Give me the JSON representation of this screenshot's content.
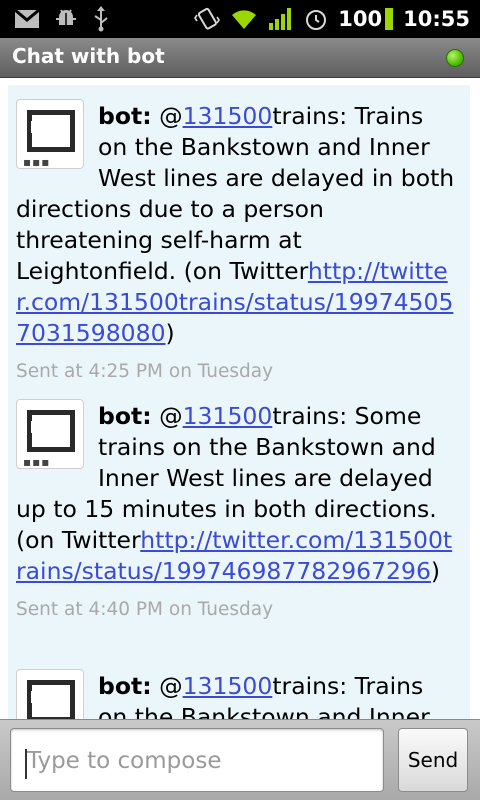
{
  "status_bar": {
    "battery_level": "100",
    "time": "10:55",
    "icons": [
      "gmail-icon",
      "android-debug-icon",
      "usb-icon",
      "vibrate-icon",
      "wifi-icon",
      "signal-icon",
      "alarm-icon",
      "battery-icon"
    ]
  },
  "title_bar": {
    "title": "Chat with bot",
    "presence_color": "#4fc000"
  },
  "messages": [
    {
      "sender": "bot:",
      "at_sign": "@",
      "mention_link": "131500",
      "text_1": "trains: Trains on the Bankstown and Inner West lines are delayed in both directions due to a person threatening self-harm at Leightonfield. (on Twitter",
      "url_link": "http://twitter.com/131500trains/status/199745057031598080",
      "text_2": ")",
      "sent_at": "Sent at 4:25 PM on Tuesday"
    },
    {
      "sender": "bot:",
      "at_sign": "@",
      "mention_link": "131500",
      "text_1": "trains: Some trains on the Bankstown and Inner West lines are delayed up to 15 minutes in both directions. (on Twitter",
      "url_link": "http://twitter.com/131500trains/status/199746987782967296",
      "text_2": ")",
      "sent_at": "Sent at 4:40 PM on Tuesday"
    },
    {
      "sender": "bot:",
      "at_sign": "@",
      "mention_link": "131500",
      "text_1": "trains: Trains on the Bankstown and Inner"
    }
  ],
  "compose": {
    "placeholder": "Type to compose",
    "send_label": "Send"
  },
  "colors": {
    "link": "#3b4bd6",
    "chat_background": "#ebf6fb",
    "timestamp": "#a9a9a9"
  }
}
